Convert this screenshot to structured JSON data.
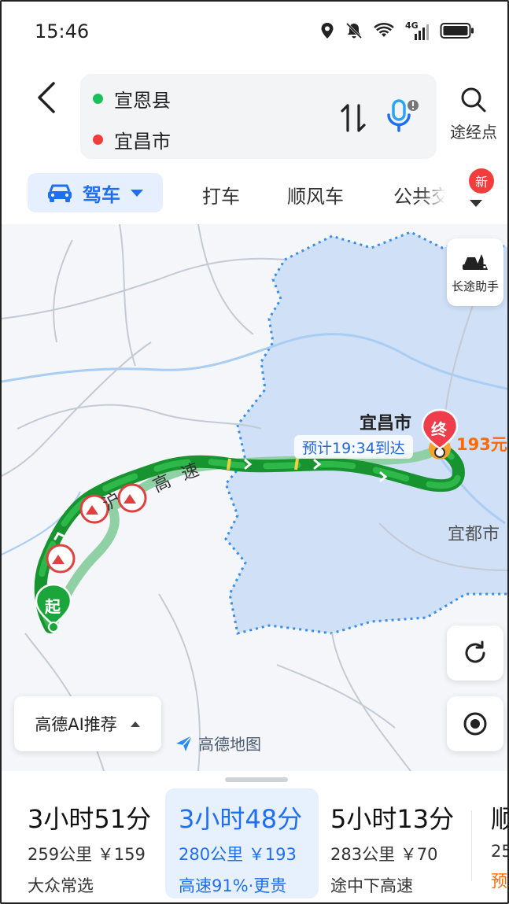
{
  "status_bar": {
    "time": "15:46",
    "icons": [
      "location-icon",
      "mute-icon",
      "wifi-icon",
      "signal-4g-icon",
      "battery-icon"
    ],
    "signal_label": "4G"
  },
  "header": {
    "origin": "宣恩县",
    "destination": "宜昌市",
    "via_label": "途经点",
    "origin_color": "#1dbf5c",
    "destination_color": "#f23d3d"
  },
  "modes": {
    "active": "驾车",
    "items": [
      "打车",
      "顺风车",
      "公共交"
    ],
    "new_badge": "新",
    "accent": "#1e6ff1"
  },
  "map": {
    "end_city": "宜昌市",
    "end_marker": "终",
    "start_marker": "起",
    "eta": "预计19:34到达",
    "price": "193元",
    "nearby_city": "宜都市",
    "highway_chars": [
      "沪",
      "高",
      "速"
    ],
    "trip_assistant": "长途助手",
    "ai_recommend": "高德AI推荐",
    "logo": "高德地图",
    "route_color": "#1aa63a",
    "region_color": "#cfe0f7"
  },
  "routes": [
    {
      "duration": "3小时51分",
      "distance": "259公里",
      "price": "￥159",
      "tag": "大众常选"
    },
    {
      "duration": "3小时48分",
      "distance": "280公里",
      "price": "￥193",
      "tag": "高速91%·更贵"
    },
    {
      "duration": "5小时13分",
      "distance": "283公里",
      "price": "￥70",
      "tag": "途中下高速"
    },
    {
      "duration": "顺",
      "distance": "25",
      "price": "",
      "tag": "预"
    }
  ]
}
